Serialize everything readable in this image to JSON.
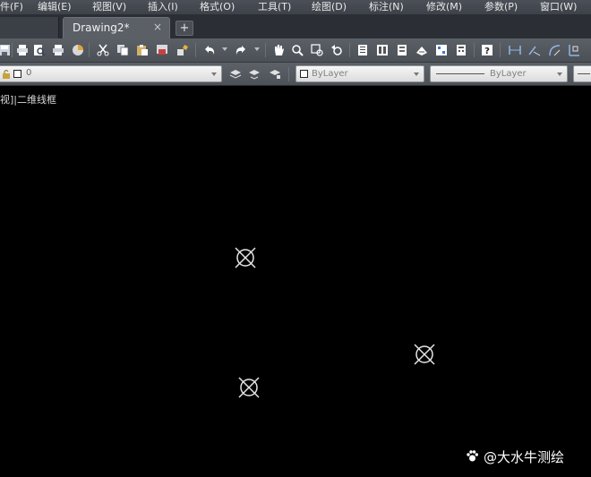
{
  "menubar": {
    "items": [
      "件(F)",
      "编辑(E)",
      "视图(V)",
      "插入(I)",
      "格式(O)",
      "工具(T)",
      "绘图(D)",
      "标注(N)",
      "修改(M)",
      "参数(P)",
      "窗口(W)"
    ]
  },
  "tabs": {
    "active": "Drawing2*",
    "close_glyph": "×",
    "add_glyph": "+"
  },
  "toolbar": {
    "icons": [
      "save-icon",
      "print-icon",
      "print-preview-icon",
      "plot-icon",
      "publish-icon",
      "cut-icon",
      "copy-icon",
      "paste-icon",
      "match-properties-icon",
      "block-editor-icon",
      "undo-icon",
      "redo-icon",
      "pan-icon",
      "zoom-realtime-icon",
      "zoom-window-icon",
      "zoom-previous-icon",
      "properties-icon",
      "design-center-icon",
      "tool-palettes-icon",
      "sheet-set-icon",
      "markup-icon",
      "quickcalc-icon",
      "help-icon",
      "linear-dimension-icon",
      "aligned-dimension-icon",
      "arc-dimension-icon",
      "ordinate-dimension-icon"
    ]
  },
  "properties": {
    "layer": "0",
    "color": "ByLayer",
    "linetype": "ByLayer"
  },
  "canvas": {
    "viewport_label": "视]|二维线框",
    "background": "#000000",
    "marker_color": "#e6e6e6"
  },
  "watermark": {
    "text": "@大水牛测绘"
  }
}
